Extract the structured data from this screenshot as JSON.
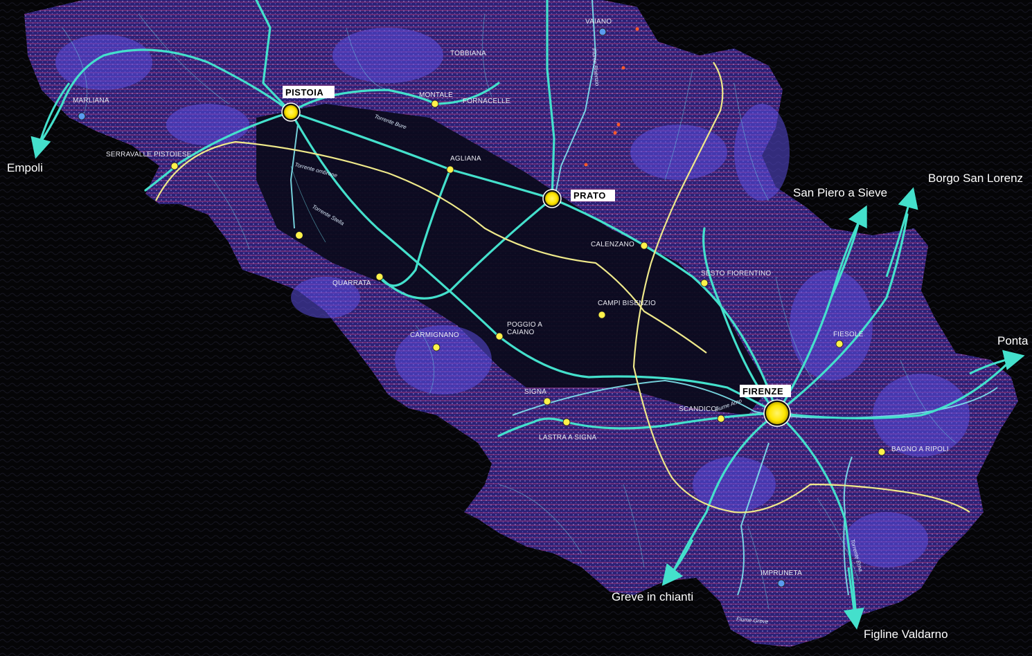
{
  "palette": {
    "background": "#000000",
    "territory": "#2a1f6e",
    "territory_dark": "#14102e",
    "plain": "#0c0c22",
    "road": "#44e0cc",
    "rail": "#f2ec8c",
    "town_dot": "#fff24a",
    "hatch": "#a83a78",
    "settlement": "#8a7cff",
    "minor": "#6fd7e6"
  },
  "map": {
    "cities": [
      {
        "id": "pistoia",
        "label": "PISTOIA"
      },
      {
        "id": "prato",
        "label": "PRATO"
      },
      {
        "id": "firenze",
        "label": "FIRENZE"
      }
    ],
    "towns": [
      {
        "id": "montale",
        "label": "MONTALE"
      },
      {
        "id": "fornacelle",
        "label": "FORNACELLE"
      },
      {
        "id": "agliana",
        "label": "AGLIANA"
      },
      {
        "id": "serravalle",
        "label": "SERRAVALLE PISTOIESE"
      },
      {
        "id": "marliana",
        "label": "MARLIANA"
      },
      {
        "id": "quarrata",
        "label": "QUARRATA"
      },
      {
        "id": "carmignano",
        "label": "CARMIGNANO"
      },
      {
        "id": "poggio",
        "label": "POGGIO A\nCAIANO"
      },
      {
        "id": "calenzano",
        "label": "CALENZANO"
      },
      {
        "id": "sesto",
        "label": "SESTO FIORENTINO"
      },
      {
        "id": "campi",
        "label": "CAMPI BISENZIO"
      },
      {
        "id": "signa",
        "label": "SIGNA"
      },
      {
        "id": "lastra",
        "label": "LASTRA A SIGNA"
      },
      {
        "id": "scandicci",
        "label": "SCANDICCI"
      },
      {
        "id": "fiesole",
        "label": "FIESOLE"
      },
      {
        "id": "bagno",
        "label": "BAGNO A RIPOLI"
      },
      {
        "id": "impruneta",
        "label": "IMPRUNETA"
      },
      {
        "id": "vaiano",
        "label": "VAIANO"
      },
      {
        "id": "tobbiana",
        "label": "TOBBIANA"
      }
    ],
    "rivers": [
      {
        "id": "bisenzio",
        "label": "Fiume Bisenzio"
      },
      {
        "id": "arno",
        "label": "Fiume Arno"
      },
      {
        "id": "greve",
        "label": "Fiume Greve"
      },
      {
        "id": "ema",
        "label": "Torrente Ema"
      },
      {
        "id": "ombrone",
        "label": "Torrente ombrone"
      },
      {
        "id": "stella",
        "label": "Torrente Stella"
      },
      {
        "id": "bure",
        "label": "Torrente Bure"
      }
    ],
    "destinations": [
      {
        "id": "empoli",
        "label": "Empoli"
      },
      {
        "id": "san-piero",
        "label": "San Piero a Sieve"
      },
      {
        "id": "borgo",
        "label": "Borgo San Lorenz"
      },
      {
        "id": "ponta",
        "label": "Ponta"
      },
      {
        "id": "greve-chianti",
        "label": "Greve in chianti"
      },
      {
        "id": "figline",
        "label": "Figline Valdarno"
      }
    ]
  }
}
